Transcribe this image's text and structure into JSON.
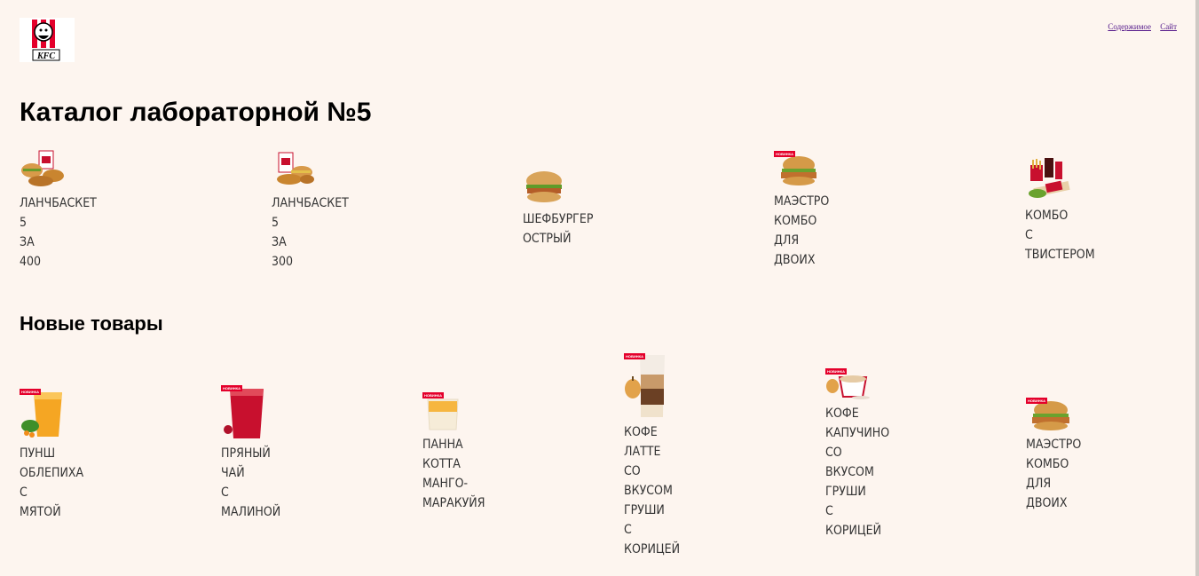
{
  "header": {
    "logo_text": "KFC",
    "nav": [
      {
        "label": "Содержимое"
      },
      {
        "label": "Сайт"
      }
    ]
  },
  "catalog": {
    "title": "Каталог лабораторной №5",
    "items": [
      {
        "name": "ЛАНЧБАСКЕТ 5 ЗА 400",
        "badge": ""
      },
      {
        "name": "ЛАНЧБАСКЕТ 5 ЗА 300",
        "badge": ""
      },
      {
        "name": "ШЕФБУРГЕР ОСТРЫЙ",
        "badge": ""
      },
      {
        "name": "МАЭСТРО КОМБО ДЛЯ ДВОИХ",
        "badge": "НОВИНКА"
      },
      {
        "name": "КОМБО С ТВИСТЕРОМ",
        "badge": ""
      }
    ]
  },
  "new_products": {
    "title": "Новые товары",
    "items": [
      {
        "name": "ПУНШ ОБЛЕПИХА С МЯТОЙ",
        "badge": "НОВИНКА"
      },
      {
        "name": "ПРЯНЫЙ ЧАЙ С МАЛИНОЙ",
        "badge": "НОВИНКА"
      },
      {
        "name": "ПАННА КОТТА МАНГО-МАРАКУЙЯ",
        "badge": "НОВИНКА"
      },
      {
        "name": "КОФЕ ЛАТТЕ СО ВКУСОМ ГРУШИ С КОРИЦЕЙ",
        "badge": "НОВИНКА"
      },
      {
        "name": "КОФЕ КАПУЧИНО СО ВКУСОМ ГРУШИ С КОРИЦЕЙ",
        "badge": "НОВИНКА"
      },
      {
        "name": "МАЭСТРО КОМБО ДЛЯ ДВОИХ",
        "badge": "НОВИНКА"
      }
    ]
  }
}
